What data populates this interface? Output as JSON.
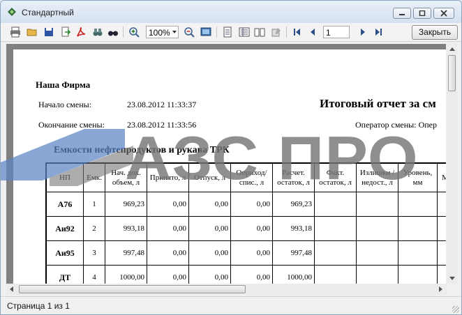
{
  "window": {
    "title": "Стандартный"
  },
  "toolbar": {
    "zoom": "100%",
    "page": "1",
    "close_label": "Закрыть"
  },
  "report": {
    "company": "Наша Фирма",
    "shift_start_label": "Начало смены:",
    "shift_start": "23.08.2012 11:33:37",
    "shift_end_label": "Окончание смены:",
    "shift_end": "23.08.2012 11:33:56",
    "title": "Итоговый отчет за см",
    "operator": "Оператор смены: Опер",
    "section": "Емкости нефтепродуктов и рукава ТРК",
    "columns": [
      "НП",
      "Емк.",
      "Нач. док. объем, л",
      "Принято, л",
      "Отпуск, л",
      "Оприход/ спис., л",
      "Расчет. остаток, л",
      "Факт. остаток, л",
      "Излишки /недост., л",
      "Уровень, мм",
      "М"
    ],
    "rows": [
      {
        "np": "А76",
        "tank": "1",
        "start": "969,23",
        "received": "0,00",
        "issued": "0,00",
        "posted": "0,00",
        "calc": "969,23"
      },
      {
        "np": "Аи92",
        "tank": "2",
        "start": "993,18",
        "received": "0,00",
        "issued": "0,00",
        "posted": "0,00",
        "calc": "993,18"
      },
      {
        "np": "Аи95",
        "tank": "3",
        "start": "997,48",
        "received": "0,00",
        "issued": "0,00",
        "posted": "0,00",
        "calc": "997,48"
      },
      {
        "np": "ДТ",
        "tank": "4",
        "start": "1000,00",
        "received": "0,00",
        "issued": "0,00",
        "posted": "0,00",
        "calc": "1000,00"
      }
    ]
  },
  "watermark": {
    "text": "АЗС ПРО"
  },
  "status": {
    "page_info": "Страница 1 из 1"
  },
  "colors": {
    "watermark_gray": "#767676",
    "watermark_blue": "#5b83c4",
    "title_bar": "#d4e1f0"
  }
}
